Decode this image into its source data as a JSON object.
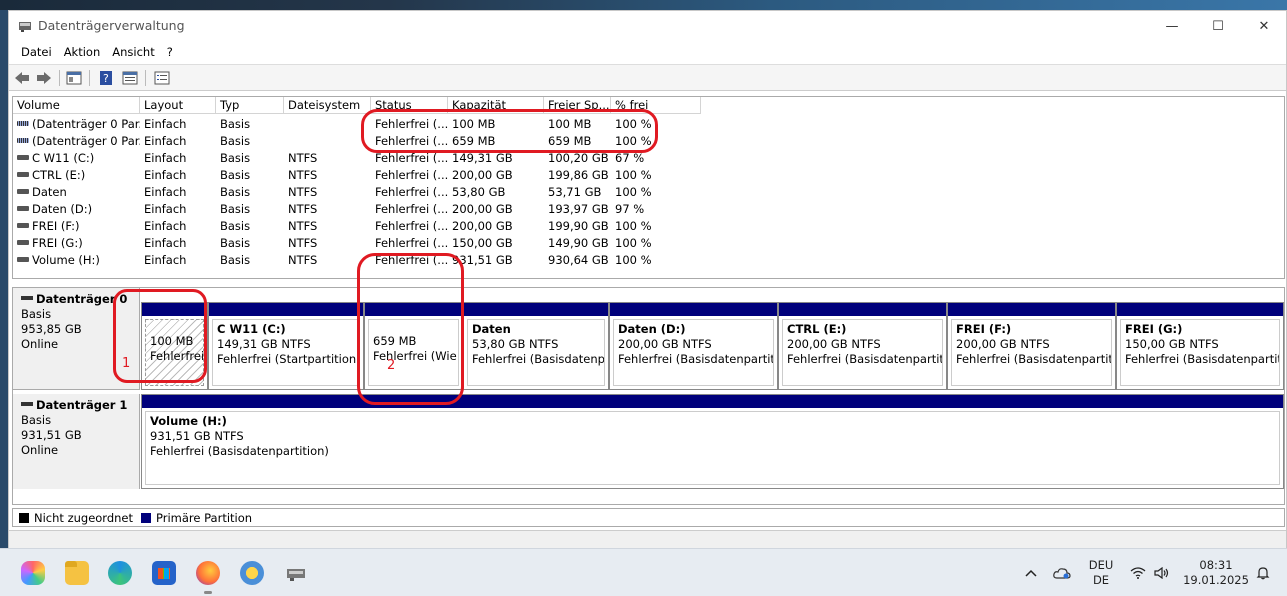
{
  "window": {
    "title": "Datenträgerverwaltung",
    "minimize": "—",
    "maximize": "☐",
    "close": "✕"
  },
  "menu": [
    "Datei",
    "Aktion",
    "Ansicht",
    "?"
  ],
  "columns": [
    "Volume",
    "Layout",
    "Typ",
    "Dateisystem",
    "Status",
    "Kapazität",
    "Freier Sp...",
    "% frei"
  ],
  "volumes": [
    {
      "name": "(Datenträger 0 Par...",
      "layout": "Einfach",
      "type": "Basis",
      "fs": "",
      "status": "Fehlerfrei (...",
      "capacity": "100 MB",
      "free": "100 MB",
      "pct": "100 %",
      "icon": "striped-volume-icon"
    },
    {
      "name": "(Datenträger 0 Par...",
      "layout": "Einfach",
      "type": "Basis",
      "fs": "",
      "status": "Fehlerfrei (...",
      "capacity": "659 MB",
      "free": "659 MB",
      "pct": "100 %",
      "icon": "striped-volume-icon"
    },
    {
      "name": "C W11 (C:)",
      "layout": "Einfach",
      "type": "Basis",
      "fs": "NTFS",
      "status": "Fehlerfrei (...",
      "capacity": "149,31 GB",
      "free": "100,20 GB",
      "pct": "67 %",
      "icon": "volume-icon"
    },
    {
      "name": "CTRL (E:)",
      "layout": "Einfach",
      "type": "Basis",
      "fs": "NTFS",
      "status": "Fehlerfrei (...",
      "capacity": "200,00 GB",
      "free": "199,86 GB",
      "pct": "100 %",
      "icon": "volume-icon"
    },
    {
      "name": "Daten",
      "layout": "Einfach",
      "type": "Basis",
      "fs": "NTFS",
      "status": "Fehlerfrei (...",
      "capacity": "53,80 GB",
      "free": "53,71 GB",
      "pct": "100 %",
      "icon": "volume-icon"
    },
    {
      "name": "Daten (D:)",
      "layout": "Einfach",
      "type": "Basis",
      "fs": "NTFS",
      "status": "Fehlerfrei (...",
      "capacity": "200,00 GB",
      "free": "193,97 GB",
      "pct": "97 %",
      "icon": "volume-icon"
    },
    {
      "name": "FREI (F:)",
      "layout": "Einfach",
      "type": "Basis",
      "fs": "NTFS",
      "status": "Fehlerfrei (...",
      "capacity": "200,00 GB",
      "free": "199,90 GB",
      "pct": "100 %",
      "icon": "volume-icon"
    },
    {
      "name": "FREI (G:)",
      "layout": "Einfach",
      "type": "Basis",
      "fs": "NTFS",
      "status": "Fehlerfrei (...",
      "capacity": "150,00 GB",
      "free": "149,90 GB",
      "pct": "100 %",
      "icon": "volume-icon"
    },
    {
      "name": "Volume (H:)",
      "layout": "Einfach",
      "type": "Basis",
      "fs": "NTFS",
      "status": "Fehlerfrei (...",
      "capacity": "931,51 GB",
      "free": "930,64 GB",
      "pct": "100 %",
      "icon": "volume-icon"
    }
  ],
  "disk0": {
    "name": "Datenträger 0",
    "type": "Basis",
    "size": "953,85 GB",
    "state": "Online",
    "partitions": [
      {
        "title": "",
        "size": "100 MB",
        "status": "Fehlerfrei"
      },
      {
        "title": "C W11  (C:)",
        "size": "149,31 GB NTFS",
        "status": "Fehlerfrei (Startpartition, Au"
      },
      {
        "title": "",
        "size": "659 MB",
        "status": "Fehlerfrei (Wie"
      },
      {
        "title": "Daten",
        "size": "53,80 GB NTFS",
        "status": "Fehlerfrei (Basisdatenparti"
      },
      {
        "title": "Daten  (D:)",
        "size": "200,00 GB NTFS",
        "status": "Fehlerfrei (Basisdatenpartition"
      },
      {
        "title": "CTRL  (E:)",
        "size": "200,00 GB NTFS",
        "status": "Fehlerfrei (Basisdatenpartition"
      },
      {
        "title": "FREI  (F:)",
        "size": "200,00 GB NTFS",
        "status": "Fehlerfrei (Basisdatenpartitio"
      },
      {
        "title": "FREI  (G:)",
        "size": "150,00 GB NTFS",
        "status": "Fehlerfrei (Basisdatenpartition"
      }
    ]
  },
  "disk1": {
    "name": "Datenträger 1",
    "type": "Basis",
    "size": "931,51 GB",
    "state": "Online",
    "partition": {
      "title": "Volume  (H:)",
      "size": "931,51 GB NTFS",
      "status": "Fehlerfrei (Basisdatenpartition)"
    }
  },
  "legend": {
    "unallocated": "Nicht zugeordnet",
    "primary": "Primäre Partition"
  },
  "annotations": [
    "1",
    "2"
  ],
  "tray": {
    "lang1": "DEU",
    "lang2": "DE",
    "time": "08:31",
    "date": "19.01.2025"
  },
  "colors": {
    "partition_bar": "#00007b",
    "annotation": "#e01a22"
  }
}
